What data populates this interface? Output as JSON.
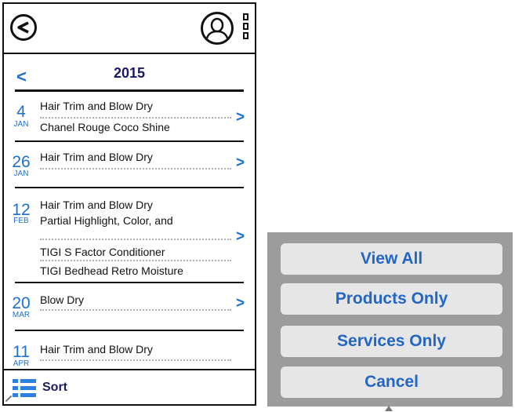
{
  "header": {
    "back_icon": "chevron-left-circle-icon",
    "user_icon": "user-profile-icon",
    "menu_icon": "vertical-menu-icon"
  },
  "year_nav": {
    "prev_label": "<",
    "year": "2015"
  },
  "entries": [
    {
      "day": "4",
      "month": "JAN",
      "lines": [
        "Hair Trim and Blow Dry",
        "Chanel Rouge Coco Shine"
      ],
      "chevron": ">"
    },
    {
      "day": "26",
      "month": "JAN",
      "lines": [
        "Hair Trim and Blow Dry"
      ],
      "chevron": ">"
    },
    {
      "day": "12",
      "month": "FEB",
      "lines": [
        "Hair Trim and Blow Dry",
        "Partial Highlight, Color, and",
        "TIGI S Factor Conditioner",
        "TIGI Bedhead Retro Moisture"
      ],
      "chevron": ">"
    },
    {
      "day": "20",
      "month": "MAR",
      "lines": [
        "Blow Dry"
      ],
      "chevron": ">"
    },
    {
      "day": "11",
      "month": "APR",
      "lines": [
        "Hair Trim and Blow Dry"
      ]
    }
  ],
  "sort": {
    "label": "Sort",
    "icon": "list-sort-icon"
  },
  "action_sheet": {
    "view_all": "View All",
    "products_only": "Products Only",
    "services_only": "Services Only",
    "cancel": "Cancel"
  },
  "colors": {
    "accent_blue": "#1f6fd1",
    "title_navy": "#1a1a66",
    "sheet_gray": "#9c9c9c",
    "sheet_button": "#e6e6e6"
  }
}
